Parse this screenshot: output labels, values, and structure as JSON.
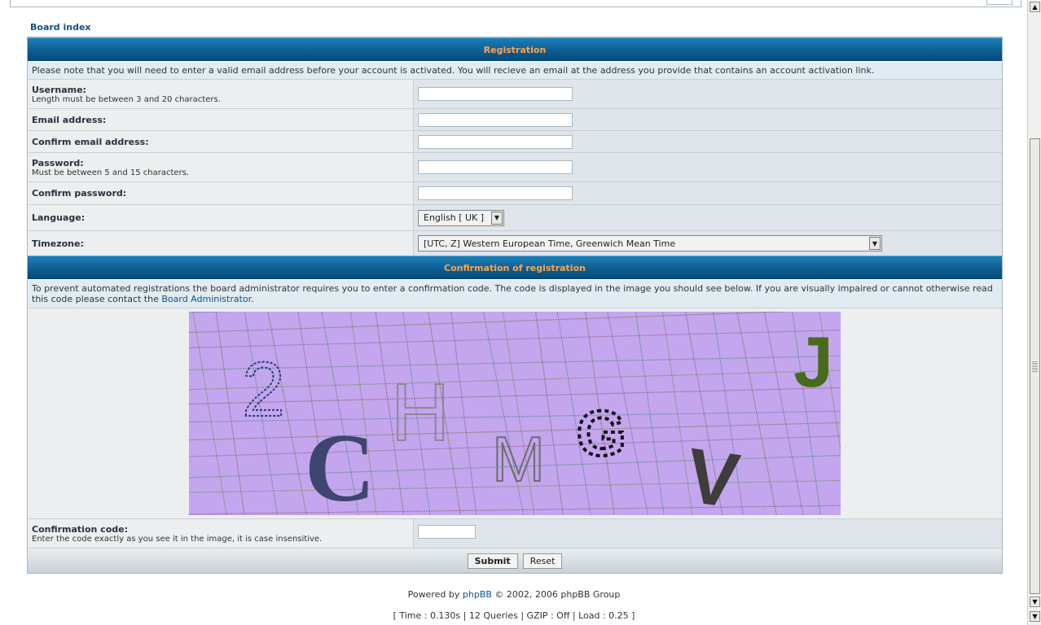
{
  "nav": {
    "board_index": "Board index"
  },
  "registration": {
    "header": "Registration",
    "note": "Please note that you will need to enter a valid email address before your account is activated. You will recieve an email at the address you provide that contains an account activation link.",
    "fields": {
      "username_label": "Username:",
      "username_hint": "Length must be between 3 and 20 characters.",
      "email_label": "Email address:",
      "confirm_email_label": "Confirm email address:",
      "password_label": "Password:",
      "password_hint": "Must be between 5 and 15 characters.",
      "confirm_password_label": "Confirm password:",
      "language_label": "Language:",
      "language_value": "English [ UK ]",
      "timezone_label": "Timezone:",
      "timezone_value": "[UTC, Z] Western European Time, Greenwich Mean Time"
    }
  },
  "confirmation": {
    "header": "Confirmation of registration",
    "note_prefix": "To prevent automated registrations the board administrator requires you to enter a confirmation code. The code is displayed in the image you should see below. If you are visually impaired or cannot otherwise read this code please contact the ",
    "note_link": "Board Administrator",
    "note_suffix": ".",
    "captcha_chars": [
      "2",
      "C",
      "H",
      "M",
      "G",
      "V",
      "J"
    ],
    "captcha_bg": "#c3a6ee",
    "code_label": "Confirmation code:",
    "code_hint": "Enter the code exactly as you see it in the image, it is case insensitive."
  },
  "buttons": {
    "submit": "Submit",
    "reset": "Reset"
  },
  "footer": {
    "powered_prefix": "Powered by ",
    "powered_link": "phpBB",
    "powered_suffix": " © 2002, 2006 phpBB Group",
    "stats": "[ Time : 0.130s | 12 Queries | GZIP : Off | Load : 0.25 ]"
  },
  "icons": {
    "scroll_up": "▲",
    "scroll_down": "▼",
    "select_arrow": "▼"
  }
}
